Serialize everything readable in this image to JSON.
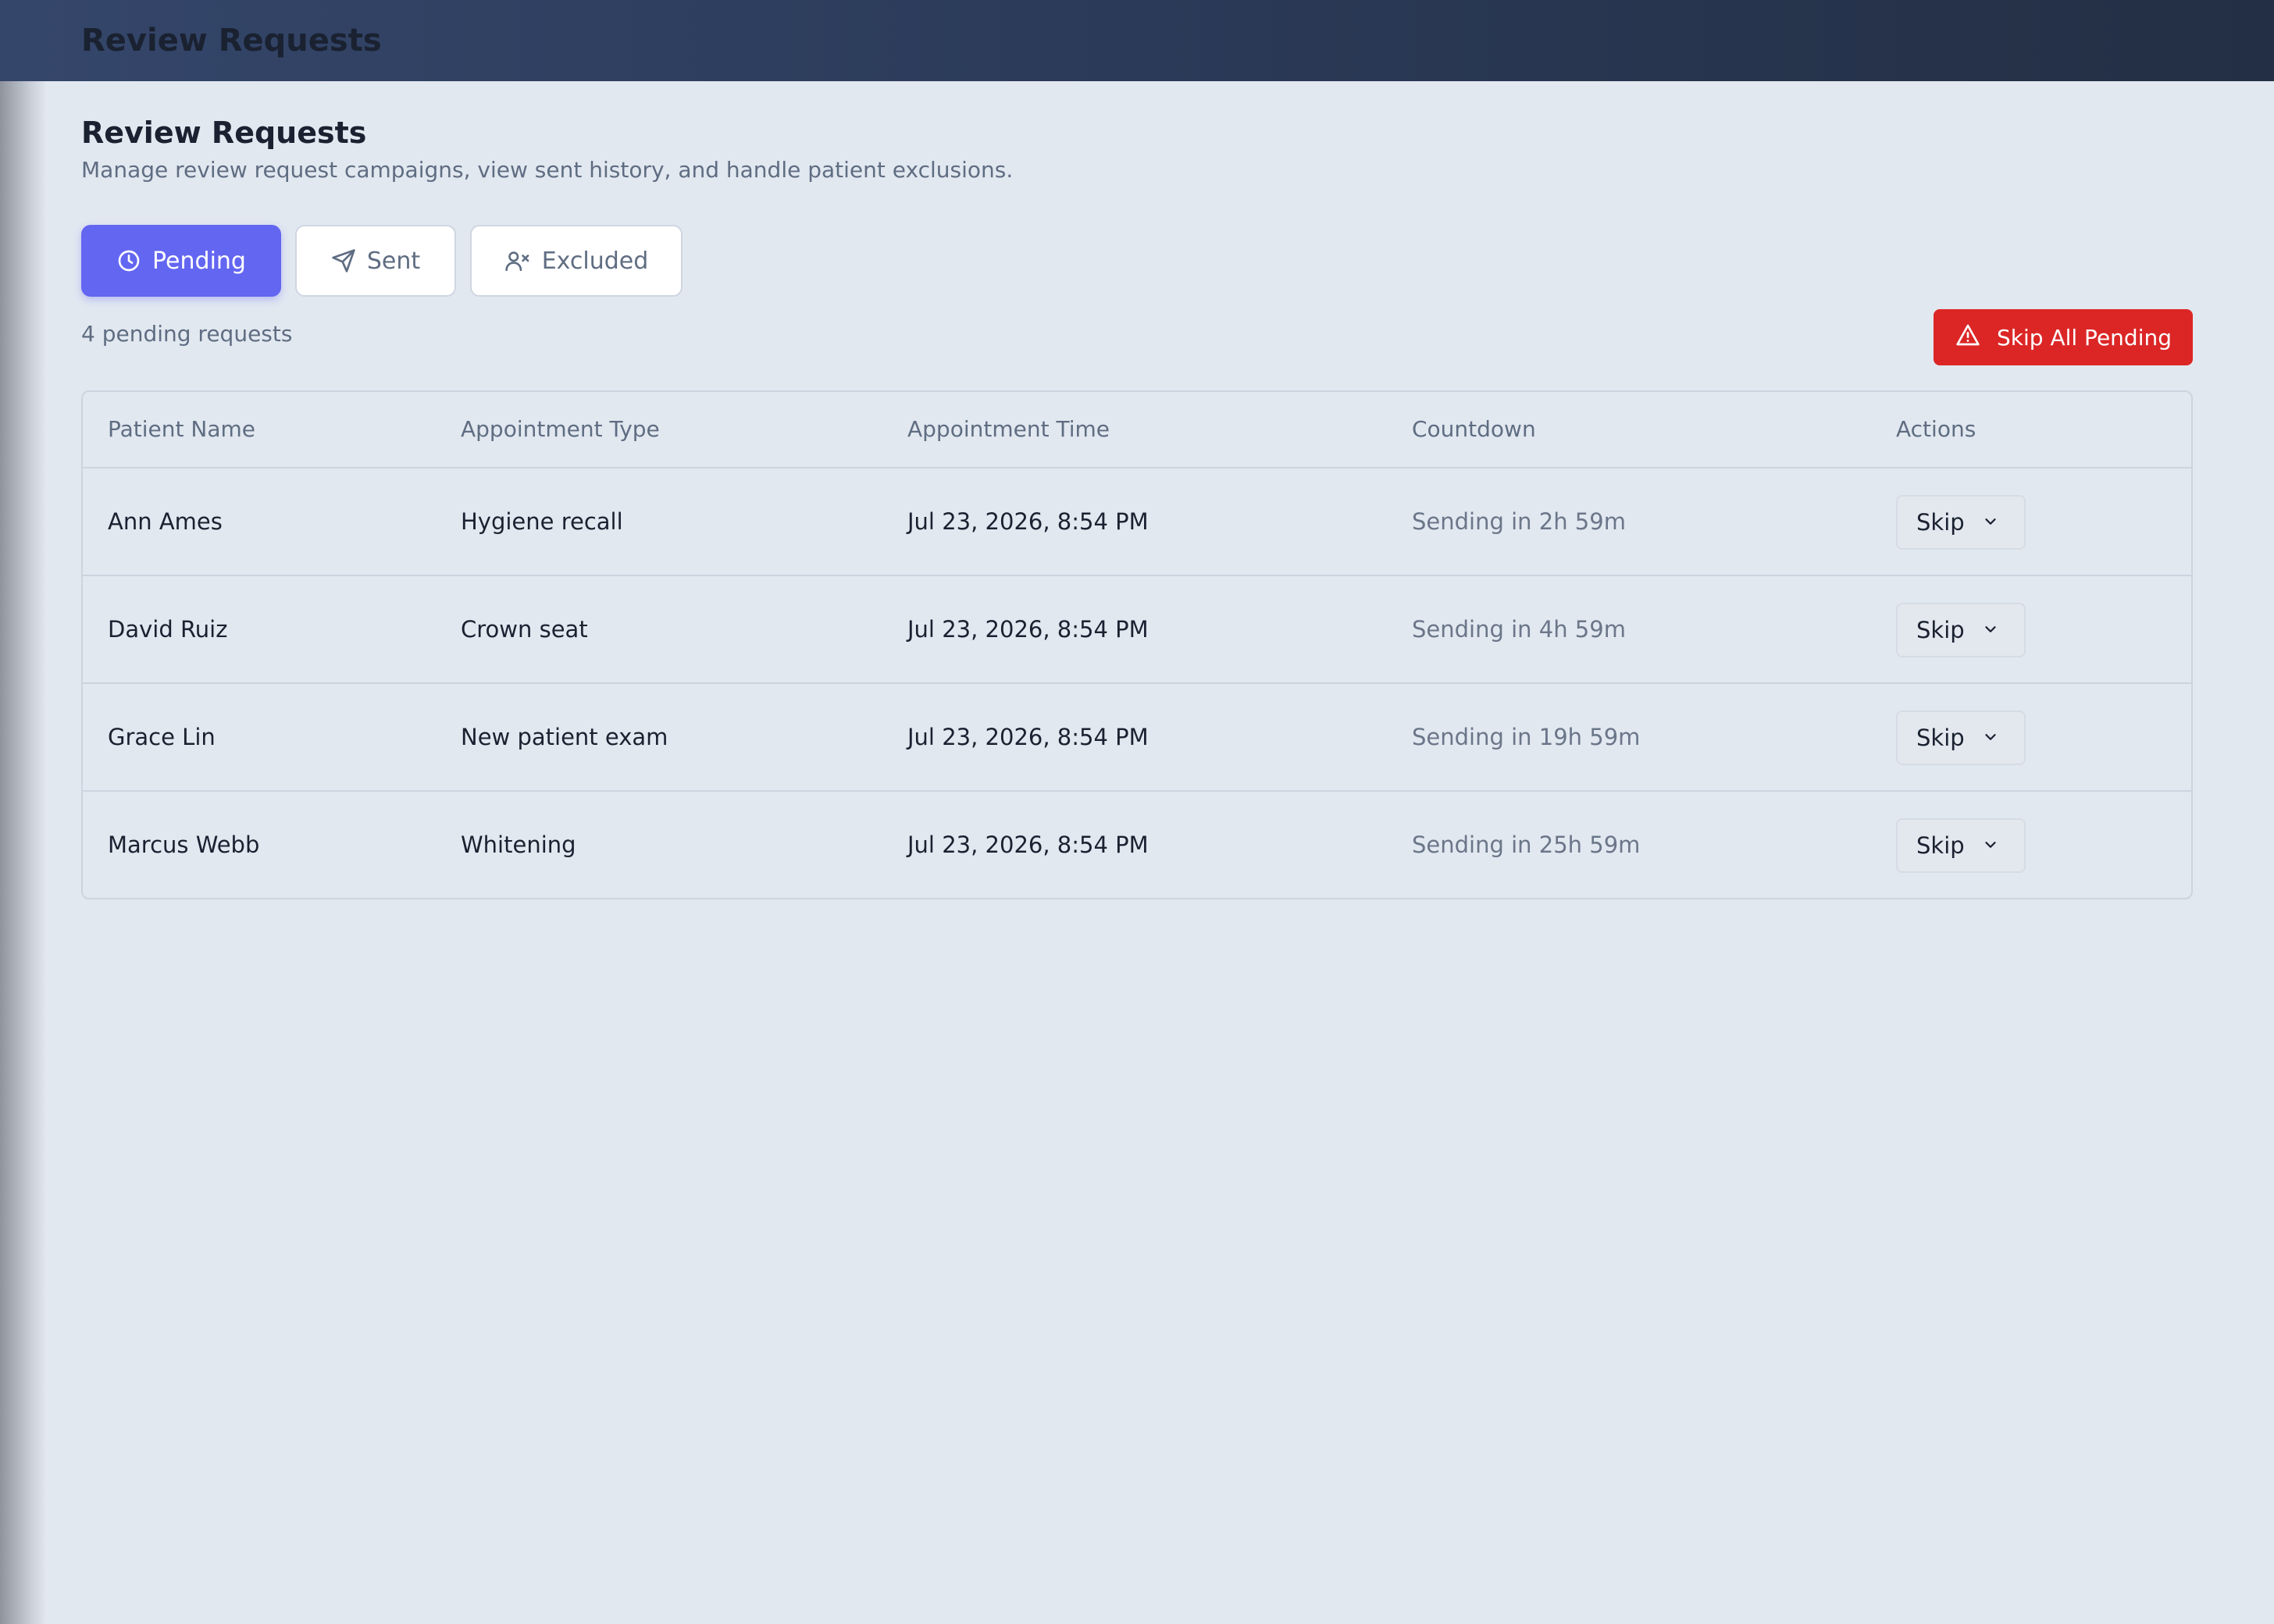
{
  "header": {
    "title": "Review Requests"
  },
  "page": {
    "title": "Review Requests",
    "subtitle": "Manage review request campaigns, view sent history, and handle patient exclusions."
  },
  "tabs": [
    {
      "label": "Pending",
      "icon": "clock-icon",
      "active": true
    },
    {
      "label": "Sent",
      "icon": "send-icon",
      "active": false
    },
    {
      "label": "Excluded",
      "icon": "user-x-icon",
      "active": false
    }
  ],
  "summary": {
    "count_text": "4 pending requests"
  },
  "skip_all": {
    "label": "Skip All Pending",
    "icon": "warning-triangle-icon",
    "color": "#dc2626"
  },
  "table": {
    "columns": [
      "Patient Name",
      "Appointment Type",
      "Appointment Time",
      "Countdown",
      "Actions"
    ],
    "rows": [
      {
        "patient": "Ann Ames",
        "type": "Hygiene recall",
        "time": "Jul 23, 2026, 8:54 PM",
        "countdown": "Sending in 2h 59m",
        "action": "Skip"
      },
      {
        "patient": "David Ruiz",
        "type": "Crown seat",
        "time": "Jul 23, 2026, 8:54 PM",
        "countdown": "Sending in 4h 59m",
        "action": "Skip"
      },
      {
        "patient": "Grace Lin",
        "type": "New patient exam",
        "time": "Jul 23, 2026, 8:54 PM",
        "countdown": "Sending in 19h 59m",
        "action": "Skip"
      },
      {
        "patient": "Marcus Webb",
        "type": "Whitening",
        "time": "Jul 23, 2026, 8:54 PM",
        "countdown": "Sending in 25h 59m",
        "action": "Skip"
      }
    ]
  },
  "colors": {
    "accent": "#6366f1",
    "danger": "#dc2626",
    "background": "#e2e8f0"
  }
}
